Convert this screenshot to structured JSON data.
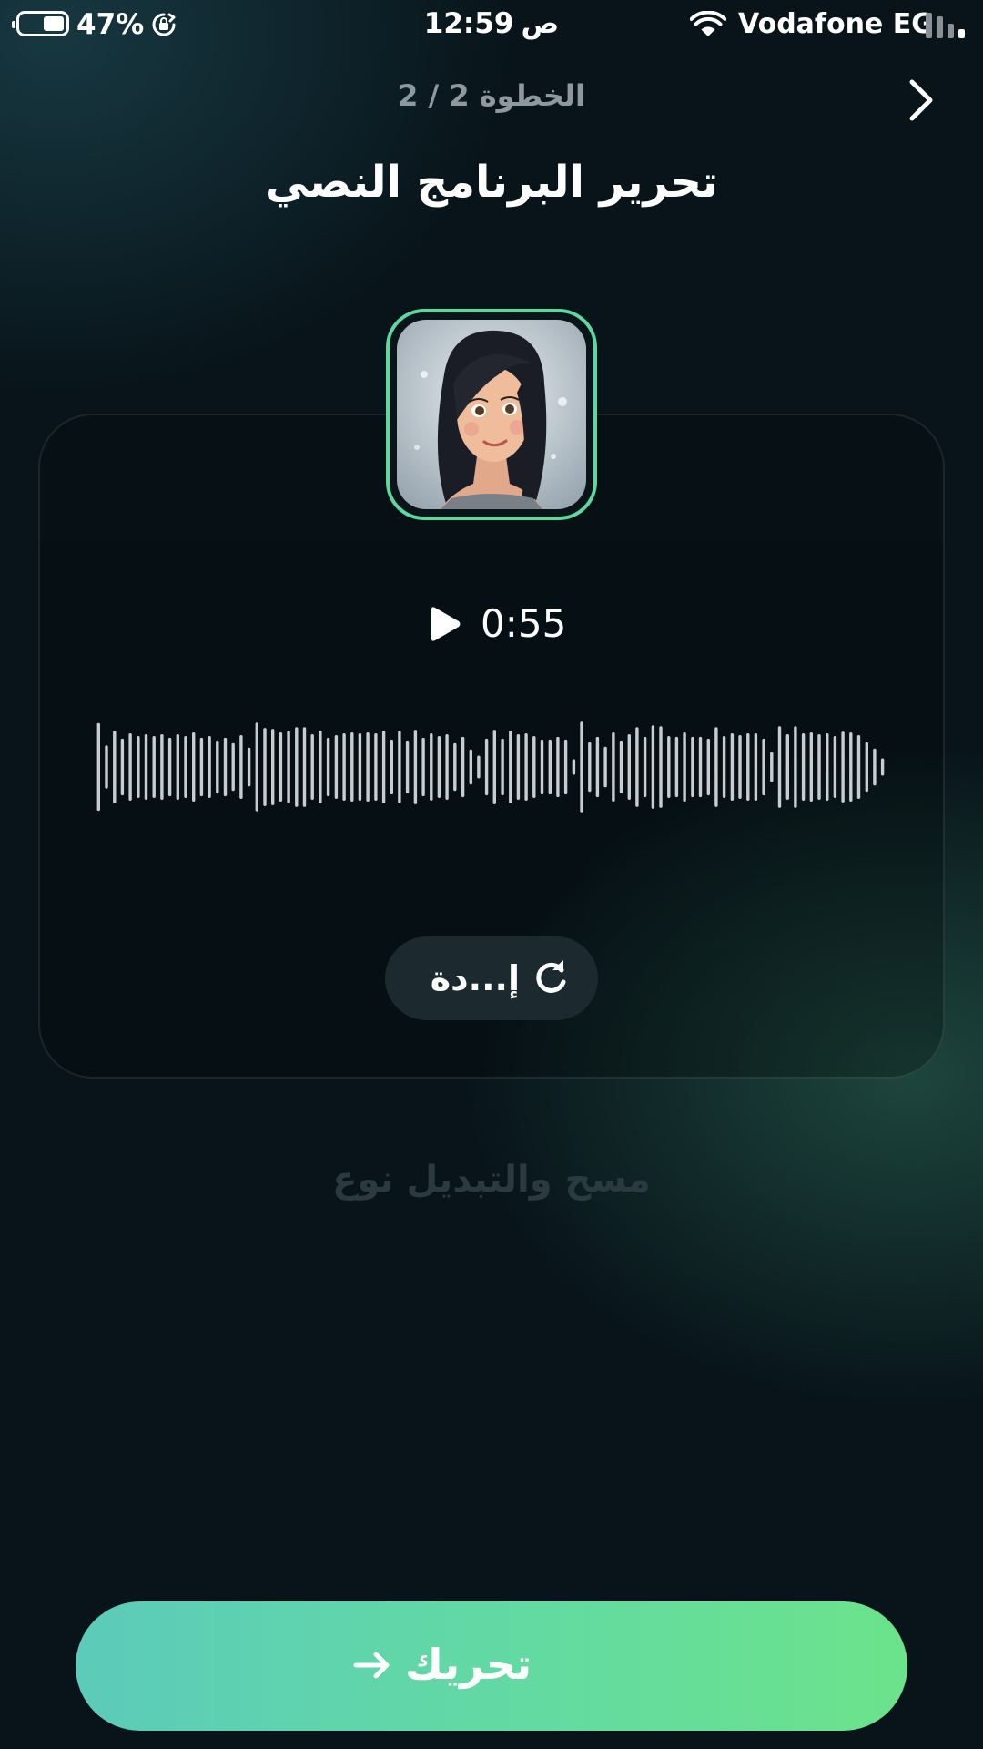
{
  "status_bar": {
    "battery_percent_label": "47%",
    "battery_level": 0.47,
    "time": "12:59",
    "time_suffix": "ص",
    "carrier": "Vodafone EG",
    "icons": [
      "battery-icon",
      "rotation-lock-icon",
      "wifi-icon",
      "signal-icon"
    ]
  },
  "header": {
    "step": "الخطوة 2 / 2",
    "title": "تحرير البرنامج النصي",
    "back_icon": "chevron-right-icon"
  },
  "player": {
    "avatar": "avatar",
    "duration": "0:55",
    "play_icon": "play-icon",
    "waveform_levels": [
      0.95,
      0.45,
      0.78,
      0.6,
      0.72,
      0.66,
      0.7,
      0.66,
      0.7,
      0.62,
      0.7,
      0.66,
      0.74,
      0.62,
      0.66,
      0.56,
      0.62,
      0.5,
      0.68,
      0.4,
      0.96,
      0.84,
      0.82,
      0.74,
      0.78,
      0.86,
      0.86,
      0.7,
      0.78,
      0.62,
      0.68,
      0.72,
      0.74,
      0.72,
      0.74,
      0.72,
      0.78,
      0.58,
      0.78,
      0.56,
      0.8,
      0.62,
      0.72,
      0.66,
      0.7,
      0.5,
      0.64,
      0.36,
      0.22,
      0.6,
      0.8,
      0.6,
      0.78,
      0.7,
      0.72,
      0.66,
      0.58,
      0.58,
      0.64,
      0.58,
      0.14,
      0.98,
      0.52,
      0.64,
      0.42,
      0.74,
      0.56,
      0.7,
      0.86,
      0.64,
      0.9,
      0.88,
      0.66,
      0.64,
      0.74,
      0.64,
      0.64,
      0.6,
      0.86,
      0.66,
      0.72,
      0.68,
      0.72,
      0.72,
      0.6,
      0.3,
      0.88,
      0.7,
      0.88,
      0.72,
      0.74,
      0.7,
      0.72,
      0.66,
      0.76,
      0.74,
      0.68,
      0.52,
      0.38,
      0.16
    ],
    "regenerate_label": "إ...دة",
    "refresh_icon": "refresh-icon"
  },
  "clear_switch_label": "مسح والتبديل نوع",
  "cta": {
    "label": "تحريك",
    "arrow_icon": "arrow-right-icon"
  },
  "colors": {
    "accent_start": "#5ccbba",
    "accent_end": "#6be38b",
    "avatar_border": "#5fd7a0",
    "background": "#08141a"
  }
}
